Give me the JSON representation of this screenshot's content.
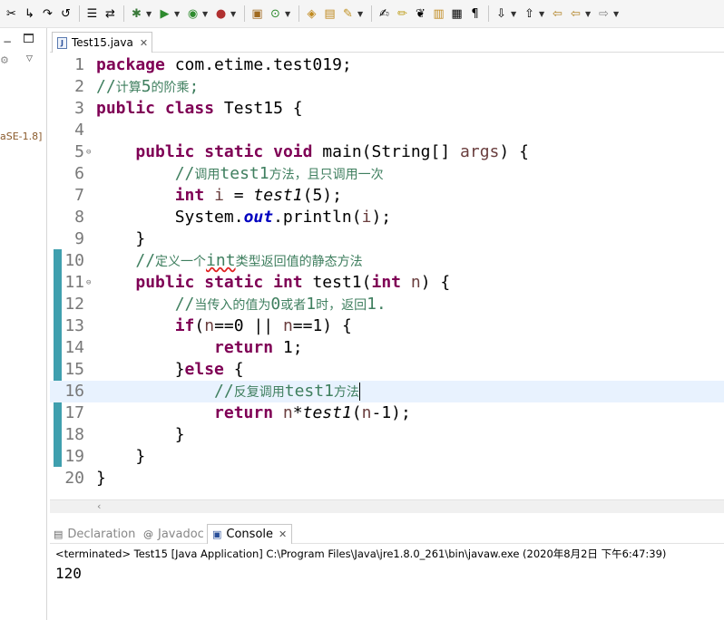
{
  "toolbar": {
    "icons": [
      "bug-icon",
      "skip-icon",
      "gear-icon",
      "run-icon",
      "coverage-icon",
      "external-tools-icon",
      "new-package-icon",
      "new-class-icon",
      "open-type-icon",
      "search-icon",
      "pen-icon",
      "annotation-icon",
      "show-whitespace-icon",
      "next-annotation-icon",
      "prev-annotation-icon",
      "back-icon",
      "forward-icon"
    ]
  },
  "left_panel": {
    "minimize_glyph": "−",
    "library_label": "aSE-1.8]"
  },
  "editor": {
    "tab_label": "Test15.java",
    "tab_icon": "J",
    "close_glyph": "✕",
    "current_line": 16,
    "lines": [
      {
        "n": "1",
        "text": "package com.etime.test019;"
      },
      {
        "n": "2",
        "text": "//计算5的阶乘;"
      },
      {
        "n": "3",
        "text": "public class Test15 {"
      },
      {
        "n": "4",
        "text": ""
      },
      {
        "n": "5",
        "text": "public static void main(String[] args) {"
      },
      {
        "n": "6",
        "text": "//调用test1方法，且只调用一次"
      },
      {
        "n": "7",
        "text": "int i = test1(5);"
      },
      {
        "n": "8",
        "text": "System.out.println(i);"
      },
      {
        "n": "9",
        "text": "}"
      },
      {
        "n": "10",
        "text": "//定义一个int类型返回值的静态方法"
      },
      {
        "n": "11",
        "text": "public static int test1(int n) {"
      },
      {
        "n": "12",
        "text": "//当传入的值为0或者1时，返回1."
      },
      {
        "n": "13",
        "text": "if(n==0 || n==1) {"
      },
      {
        "n": "14",
        "text": "return 1;"
      },
      {
        "n": "15",
        "text": "}else {"
      },
      {
        "n": "16",
        "text": "//反复调用test1方法"
      },
      {
        "n": "17",
        "text": "return n*test1(n-1);"
      },
      {
        "n": "18",
        "text": "}"
      },
      {
        "n": "19",
        "text": "}"
      },
      {
        "n": "20",
        "text": "}"
      }
    ]
  },
  "bottom_panel": {
    "tabs": [
      {
        "label": "Declaration",
        "icon": "declaration-icon"
      },
      {
        "label": "Javadoc",
        "icon": "javadoc-icon"
      },
      {
        "label": "Console",
        "icon": "console-icon"
      }
    ],
    "active_tab": "Console",
    "console_status": "<terminated> Test15 [Java Application] C:\\Program Files\\Java\\jre1.8.0_261\\bin\\javaw.exe (2020年8月2日 下午6:47:39)",
    "console_output": "120"
  },
  "colors": {
    "keyword": "#7f0055",
    "comment": "#3f7f5f",
    "field": "#0000c0",
    "current_line_bg": "#e8f2fe",
    "change_ruler": "#3f9fae"
  }
}
